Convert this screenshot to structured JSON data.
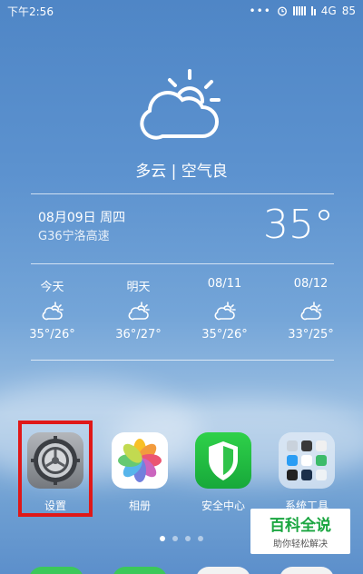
{
  "status_bar": {
    "time": "下午2:56",
    "network": "4G",
    "battery": "85"
  },
  "weather": {
    "condition": "多云 | 空气良",
    "date": "08月09日 周四",
    "location": "G36宁洛高速",
    "temperature": "35°",
    "icon": "partly-cloudy-icon",
    "forecast": [
      {
        "day": "今天",
        "range": "35°/26°",
        "icon": "partly-cloudy-icon"
      },
      {
        "day": "明天",
        "range": "36°/27°",
        "icon": "partly-cloudy-icon"
      },
      {
        "day": "08/11",
        "range": "35°/26°",
        "icon": "partly-cloudy-icon"
      },
      {
        "day": "08/12",
        "range": "33°/25°",
        "icon": "partly-cloudy-icon"
      }
    ]
  },
  "apps": [
    {
      "label": "设置",
      "icon": "settings-gear-icon"
    },
    {
      "label": "相册",
      "icon": "photos-flower-icon"
    },
    {
      "label": "安全中心",
      "icon": "security-shield-icon"
    },
    {
      "label": "系统工具",
      "icon": "folder-icon"
    }
  ],
  "pager": {
    "pages": 4,
    "active": 1
  },
  "watermark": {
    "title": "百科全说",
    "subtitle": "助你轻松解决"
  },
  "colors": {
    "highlight": "#e01818",
    "watermark_green": "#1aa640"
  }
}
